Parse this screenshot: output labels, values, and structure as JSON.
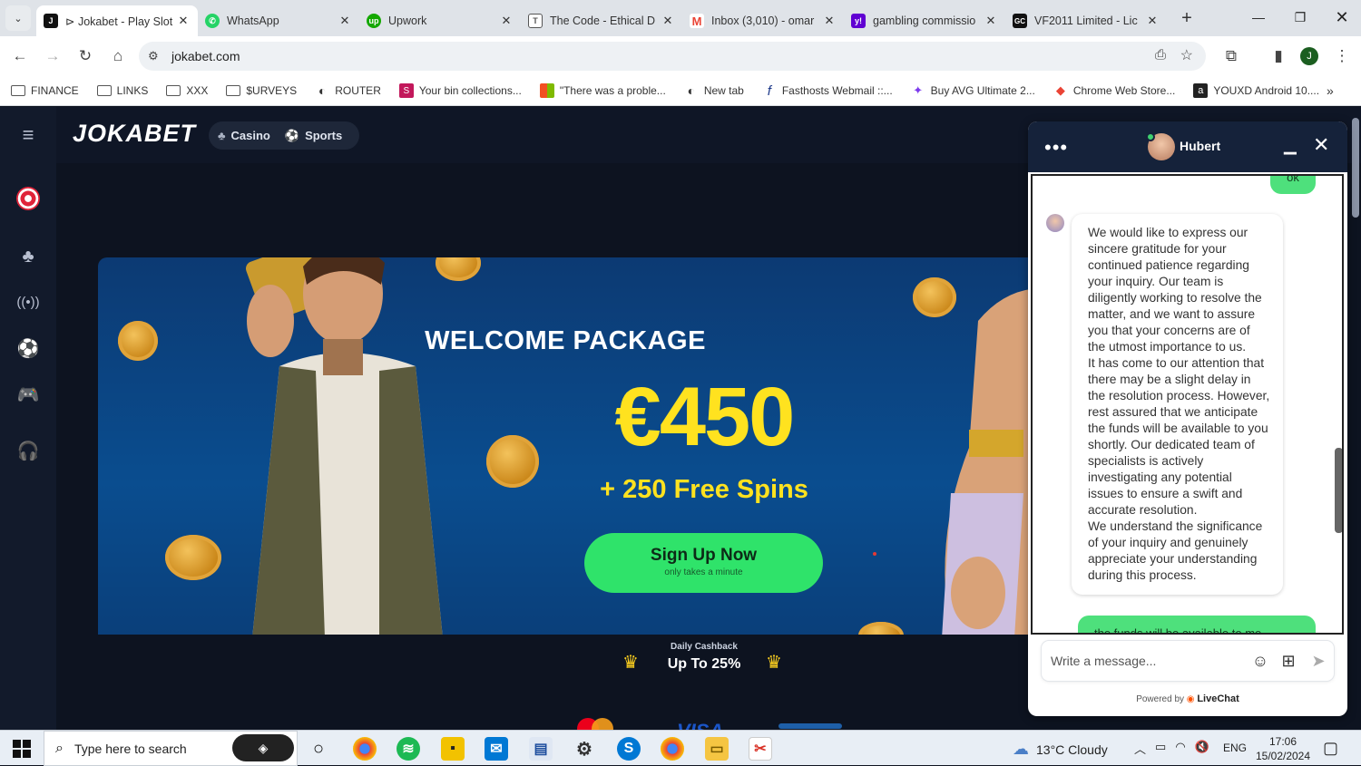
{
  "browser": {
    "tabs": [
      {
        "title": "⊳ Jokabet - Play Slot",
        "icon": "jokabet-icon",
        "color": "#111111",
        "active": true
      },
      {
        "title": "WhatsApp",
        "icon": "whatsapp-icon",
        "color": "#25d366",
        "active": false
      },
      {
        "title": "Upwork",
        "icon": "upwork-icon",
        "color": "#14a800",
        "active": false
      },
      {
        "title": "The Code - Ethical D",
        "icon": "document-icon",
        "color": "#555555",
        "active": false
      },
      {
        "title": "Inbox (3,010) - omar",
        "icon": "gmail-icon",
        "color": "#ea4335",
        "active": false
      },
      {
        "title": "gambling commissio",
        "icon": "yahoo-icon",
        "color": "#6001d2",
        "active": false
      },
      {
        "title": "VF2011 Limited - Lic",
        "icon": "gc-icon",
        "color": "#111111",
        "active": false
      }
    ],
    "url": "jokabet.com",
    "profile_initial": "J",
    "bookmarks": [
      {
        "label": "FINANCE",
        "type": "folder"
      },
      {
        "label": "LINKS",
        "type": "folder"
      },
      {
        "label": "XXX",
        "type": "folder"
      },
      {
        "label": "$URVEYS",
        "type": "folder"
      },
      {
        "label": "ROUTER",
        "type": "site",
        "color": "#333333",
        "glyph": "◐"
      },
      {
        "label": "Your bin collections...",
        "type": "site",
        "color": "#c2185b",
        "glyph": "S"
      },
      {
        "label": "\"There was a proble...",
        "type": "site",
        "color": "#f25022",
        "glyph": "▦"
      },
      {
        "label": "New tab",
        "type": "site",
        "color": "#333333",
        "glyph": "◐"
      },
      {
        "label": "Fasthosts Webmail ::...",
        "type": "site",
        "color": "#1e3a8a",
        "glyph": "f"
      },
      {
        "label": "Buy AVG Ultimate 2...",
        "type": "site",
        "color": "#7c3aed",
        "glyph": "✦"
      },
      {
        "label": "Chrome Web Store...",
        "type": "site",
        "color": "#ea4335",
        "glyph": "◆"
      },
      {
        "label": "YOUXD Android 10....",
        "type": "site",
        "color": "#222222",
        "glyph": "a"
      }
    ]
  },
  "site": {
    "logo": "JOKABET",
    "nav": [
      {
        "label": "Casino",
        "icon": "cherry-icon"
      },
      {
        "label": "Sports",
        "icon": "soccer-ball-icon"
      }
    ],
    "hero": {
      "title": "WELCOME PACKAGE",
      "amount": "€450",
      "spins": "+ 250 Free Spins",
      "cta": "Sign Up Now",
      "cta_sub": "only takes a minute"
    },
    "cashback": {
      "label": "Daily Cashback",
      "value": "Up To 25%"
    },
    "payments": [
      "VISA"
    ]
  },
  "chat": {
    "agent": "Hubert",
    "prev_user_message": "ok",
    "agent_message": "We would like to express our sincere gratitude for your continued patience regarding your inquiry. Our team is diligently working to resolve the matter, and we want to assure you that your concerns are of the utmost importance to us.\nIt has come to our attention that there may be a slight delay in the resolution process. However, rest assured that we anticipate the funds will be available to you shortly. Our dedicated team of specialists is actively investigating any potential issues to ensure a swift and accurate resolution.\nWe understand the significance of your inquiry and genuinely appreciate your understanding during this process.",
    "next_user_message": "the funds will be available to me",
    "input_placeholder": "Write a message...",
    "powered_by": "Powered by",
    "powered_brand": "LiveChat"
  },
  "taskbar": {
    "search_placeholder": "Type here to search",
    "weather": "13°C  Cloudy",
    "language": "ENG",
    "time": "17:06",
    "date": "15/02/2024"
  },
  "colors": {
    "accent_green": "#2fe36a",
    "hero_yellow": "#ffe21f",
    "site_bg": "#0d1320",
    "chat_header": "#15223a"
  }
}
